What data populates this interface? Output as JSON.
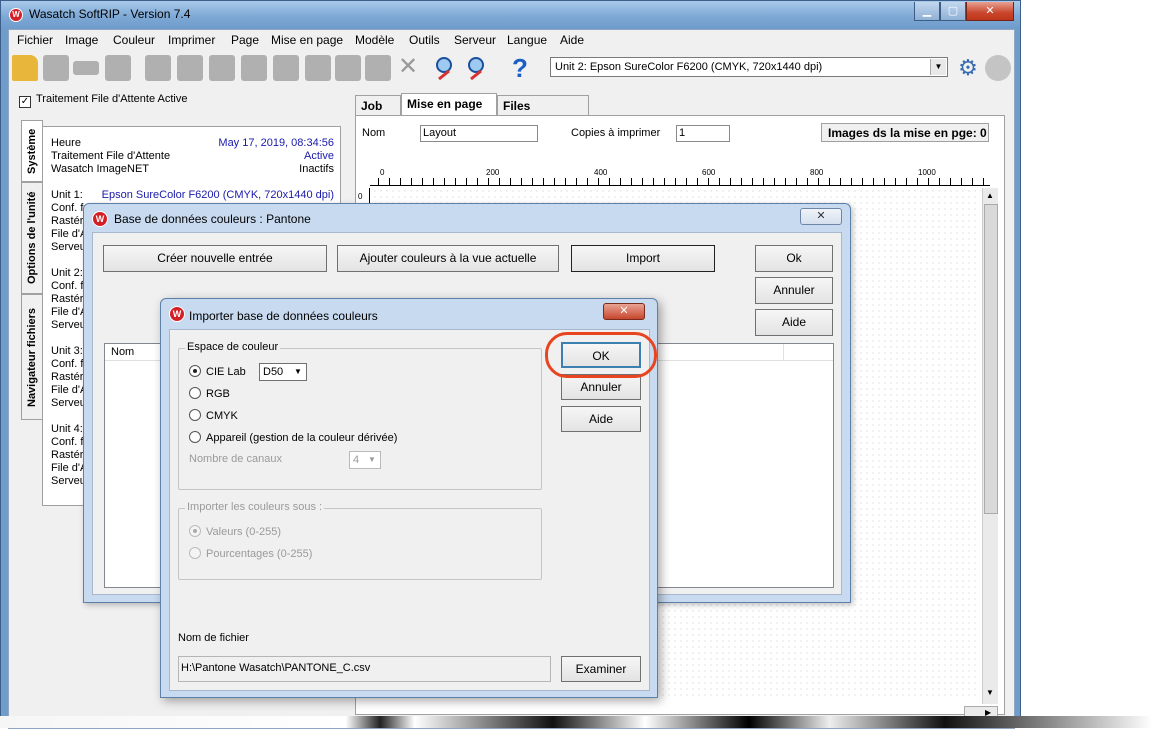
{
  "window": {
    "title": "Wasatch SoftRIP - Version 7.4"
  },
  "menu": [
    "Fichier",
    "Image",
    "Couleur",
    "Imprimer",
    "Page",
    "Mise en page",
    "Modèle",
    "Outils",
    "Serveur",
    "Langue",
    "Aide"
  ],
  "toolbar": {
    "printer": "Unit 2: Epson  SureColor F6200  (CMYK, 720x1440 dpi)"
  },
  "left_panel": {
    "queue_checkbox": "Traitement File d'Attente Active",
    "vertical_tabs": [
      "Système",
      "Options de l'unité",
      "Navigateur fichiers"
    ],
    "info": {
      "heure_label": "Heure",
      "heure_value": "May 17, 2019,  08:34:56",
      "queue_label": "Traitement File d'Attente",
      "queue_value": "Active",
      "imagenet_label": "Wasatch ImageNET",
      "imagenet_value": "Inactifs",
      "unit1_label": "Unit 1:",
      "unit1_value": "Epson  SureColor F6200  (CMYK, 720x1440 dpi)",
      "unit1_conf": "Conf. fo",
      "unit1_rast": "Rastéris",
      "unit1_file": "File d'A",
      "unit1_serv": "Serveu",
      "unit2_label": "Unit 2:",
      "unit2_conf": "Conf. fo",
      "unit2_rast": "Rastéris",
      "unit2_file": "File d'A",
      "unit2_serv": "Serveu",
      "unit3_label": "Unit 3:",
      "unit3_conf": "Conf. fo",
      "unit3_rast": "Rastéris",
      "unit3_file": "File d'A",
      "unit3_serv": "Serveu",
      "unit4_label": "Unit 4:",
      "unit4_conf": "Conf. fo",
      "unit4_rast": "Rastéris",
      "unit4_file": "File d'A",
      "unit4_serv": "Serveu"
    }
  },
  "right_panel": {
    "tabs": [
      "Job",
      "Mise en page",
      "Files d'attente"
    ],
    "nom_label": "Nom",
    "nom_value": "Layout",
    "copies_label": "Copies à imprimer",
    "copies_value": "1",
    "images_count": "Images ds la mise en pge: 0",
    "ruler_ticks": [
      "0",
      "200",
      "400",
      "600",
      "800",
      "1000"
    ],
    "ruler_v_tick": "0"
  },
  "db_dialog": {
    "title": "Base de données couleurs : Pantone",
    "buttons": {
      "create": "Créer nouvelle entrée",
      "add": "Ajouter couleurs à la vue actuelle",
      "import": "Import",
      "ok": "Ok",
      "cancel": "Annuler",
      "help": "Aide"
    },
    "list_header": "Nom"
  },
  "import_dialog": {
    "title": "Importer base de données couleurs",
    "colorspace_group": "Espace de couleur",
    "options": [
      "CIE Lab",
      "RGB",
      "CMYK",
      "Appareil (gestion de la couleur dérivée)"
    ],
    "illuminant": "D50",
    "channels_label": "Nombre de canaux",
    "channels_value": "4",
    "import_as_group": "Importer les couleurs sous :",
    "import_as_options": [
      "Valeurs (0-255)",
      "Pourcentages (0-255)"
    ],
    "filename_label": "Nom de fichier",
    "filename_value": "H:\\Pantone Wasatch\\PANTONE_C.csv",
    "buttons": {
      "ok": "OK",
      "cancel": "Annuler",
      "help": "Aide",
      "browse": "Examiner"
    }
  }
}
